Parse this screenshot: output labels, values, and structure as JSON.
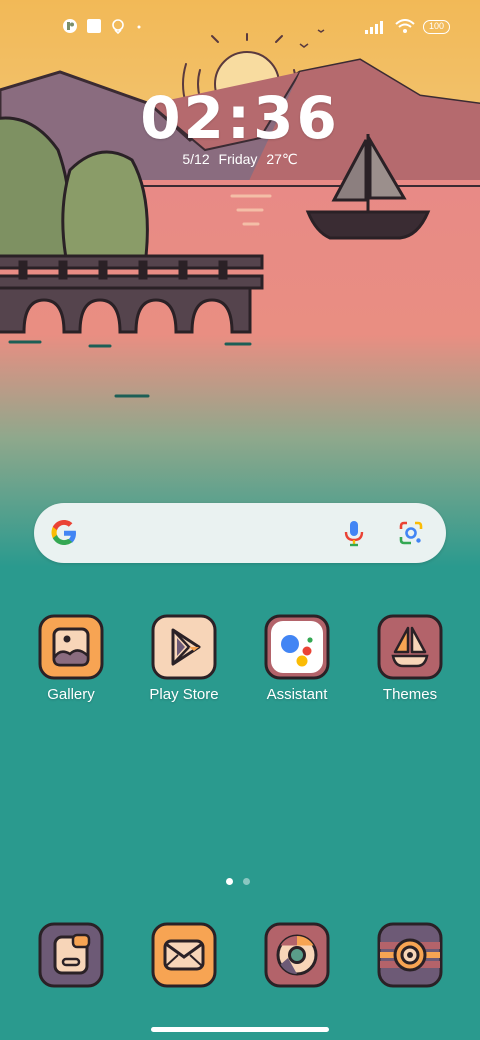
{
  "status_bar": {
    "battery": "100",
    "icons": [
      "app-notification-icon",
      "square-notification-icon",
      "location-icon",
      "dot-icon",
      "signal-icon",
      "wifi-icon"
    ]
  },
  "clock": {
    "time": "02:36",
    "date": "5/12",
    "weekday": "Friday",
    "temperature": "27℃"
  },
  "search": {
    "icons": [
      "google-logo-icon",
      "microphone-icon",
      "google-lens-icon"
    ]
  },
  "apps": [
    {
      "label": "Gallery",
      "icon": "gallery-icon"
    },
    {
      "label": "Play Store",
      "icon": "play-store-icon"
    },
    {
      "label": "Assistant",
      "icon": "assistant-icon"
    },
    {
      "label": "Themes",
      "icon": "themes-icon"
    }
  ],
  "dock": [
    {
      "icon": "phone-icon"
    },
    {
      "icon": "messages-icon"
    },
    {
      "icon": "chrome-icon"
    },
    {
      "icon": "camera-icon"
    }
  ],
  "pages": {
    "count": 2,
    "current": 1
  },
  "colors": {
    "sky": "#f2b957",
    "mountain": "#b56a6e",
    "water": "#2a9a8e",
    "icon_outline": "#2a2126",
    "icon_orange": "#f7a453",
    "icon_peach": "#f7d5b8",
    "icon_rose": "#b3636a",
    "icon_purple": "#6d5a76"
  }
}
